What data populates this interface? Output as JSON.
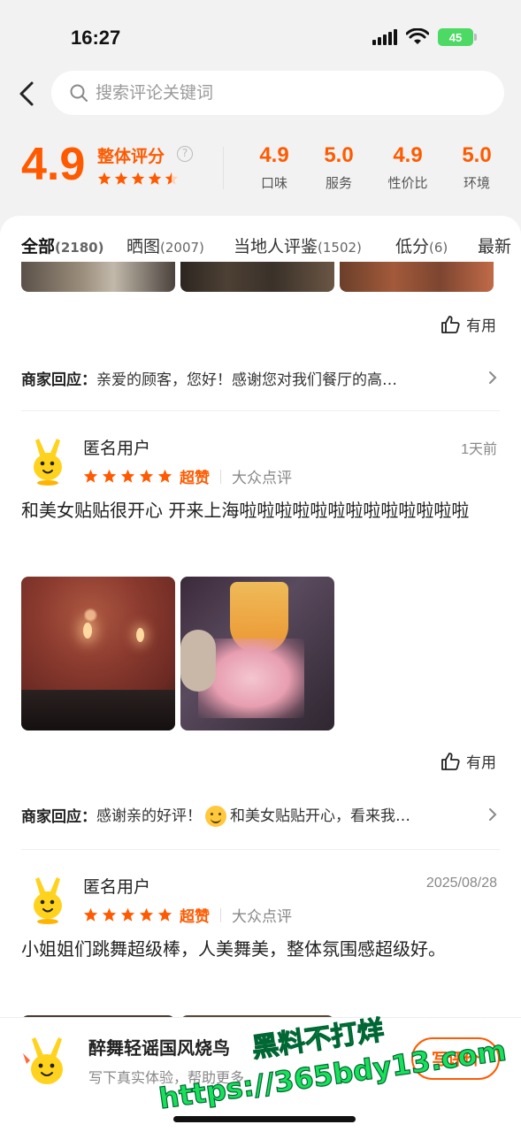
{
  "status": {
    "time": "16:27",
    "battery": "45"
  },
  "search": {
    "placeholder": "搜索评论关键词"
  },
  "summary": {
    "score": "4.9",
    "label": "整体评分",
    "help": "?",
    "rating_stars": 4.5,
    "sub_scores": [
      {
        "value": "4.9",
        "label": "口味"
      },
      {
        "value": "5.0",
        "label": "服务"
      },
      {
        "value": "4.9",
        "label": "性价比"
      },
      {
        "value": "5.0",
        "label": "环境"
      }
    ]
  },
  "tabs": [
    {
      "label": "全部",
      "count": "(2180)",
      "active": true
    },
    {
      "label": "晒图",
      "count": "(2007)"
    },
    {
      "label": "当地人评鉴",
      "count": "(1502)"
    },
    {
      "label": "低分",
      "count": "(6)"
    },
    {
      "label": "最新",
      "count": ""
    }
  ],
  "useful_label": "有用",
  "replies": [
    {
      "label": "商家回应：",
      "text": "亲爱的顾客，您好！感谢您对我们餐厅的高…"
    },
    {
      "label": "商家回应：",
      "text_before": "感谢亲的好评！",
      "emoji": "smile-emoji",
      "text_after": "和美女贴贴开心，看来我…"
    }
  ],
  "reviews": [
    {
      "user": "匿名用户",
      "date": "1天前",
      "stars": 5,
      "praise": "超赞",
      "source": "大众点评",
      "text": "和美女贴贴很开心 开来上海啦啦啦啦啦啦啦啦啦啦啦啦啦"
    },
    {
      "user": "匿名用户",
      "date": "2025/08/28",
      "stars": 5,
      "praise": "超赞",
      "source": "大众点评",
      "text": "小姐姐们跳舞超级棒，人美舞美，整体氛围感超级好。"
    }
  ],
  "bottom_bar": {
    "shop_name": "醉舞轻谣国风烧鸟",
    "hint": "写下真实体验，帮助更多",
    "button": "写评价"
  },
  "watermark": {
    "line1": "黑料不打烊",
    "line2": "https://365bdy13.com"
  },
  "colors": {
    "accent": "#ff5a00",
    "watermark": "#18e05a"
  }
}
